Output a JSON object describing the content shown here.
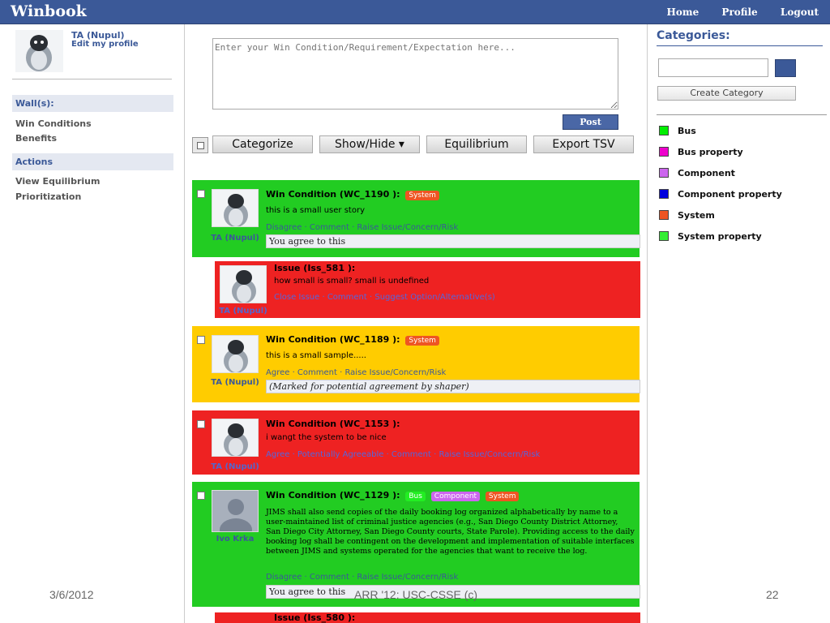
{
  "app": {
    "title": "Winbook"
  },
  "nav": {
    "home": "Home",
    "profile": "Profile",
    "logout": "Logout"
  },
  "user": {
    "name": "TA (Nupul)",
    "edit": "Edit my profile"
  },
  "sidebar": {
    "walls_heading": "Wall(s):",
    "wall_links": [
      "Win Conditions",
      "Benefits"
    ],
    "actions_heading": "Actions",
    "action_links": [
      "View Equilibrium",
      "Prioritization"
    ]
  },
  "composer": {
    "placeholder": "Enter your Win Condition/Requirement/Expectation here...",
    "post_label": "Post"
  },
  "toolbar": {
    "categorize": "Categorize",
    "showhide": "Show/Hide ▾",
    "equilibrium": "Equilibrium",
    "export": "Export TSV"
  },
  "cards": [
    {
      "type": "win",
      "author": "TA (Nupul)",
      "title": "Win Condition (WC_1190 ):",
      "tags": [
        "System"
      ],
      "body": "this is a small user story",
      "actions": "Disagree · Comment · Raise Issue/Concern/Risk",
      "note": "You agree to this"
    },
    {
      "type": "issue",
      "author": "TA (Nupul)",
      "title": "Issue (Iss_581 ):",
      "body": "how small is small? small is undefined",
      "actions": "Close Issue · Comment · Suggest Option/Alternative(s)"
    },
    {
      "type": "win",
      "author": "TA (Nupul)",
      "title": "Win Condition (WC_1189 ):",
      "tags": [
        "System"
      ],
      "body": "this is a small sample.....",
      "actions": "Agree · Comment · Raise Issue/Concern/Risk",
      "note": "(Marked for potential agreement by shaper)"
    },
    {
      "type": "win",
      "author": "TA (Nupul)",
      "title": "Win Condition (WC_1153 ):",
      "body": "i wangt the system to be nice",
      "actions": "Agree · Potentially Agreeable · Comment · Raise Issue/Concern/Risk"
    },
    {
      "type": "win",
      "author": "Ivo Krka",
      "title": "Win Condition (WC_1129 ):",
      "tags": [
        "Bus",
        "Component",
        "System"
      ],
      "body": "JIMS shall also send copies of the daily booking log organized alphabetically by name to a user-maintained list of criminal justice agencies (e.g., San Diego County District Attorney, San Diego City Attorney, San Diego County courts, State Parole). Providing access to the daily booking log shall be contingent on the development and implementation of suitable interfaces between JIMS and systems operated for the agencies that want to receive the log.",
      "actions": "Disagree · Comment · Raise Issue/Concern/Risk",
      "note": "You agree to this"
    },
    {
      "type": "issue",
      "title": "Issue (Iss_580 ):"
    }
  ],
  "tag_colors": {
    "Bus": "#22cc22",
    "Component": "#cc66ee",
    "System": "#ee5522"
  },
  "categories": {
    "heading": "Categories:",
    "create_label": "Create Category",
    "items": [
      {
        "label": "Bus",
        "color": "#00ee00"
      },
      {
        "label": "Bus property",
        "color": "#ee00cc"
      },
      {
        "label": "Component",
        "color": "#cc66ee"
      },
      {
        "label": "Component property",
        "color": "#0000dd"
      },
      {
        "label": "System",
        "color": "#ee5522"
      },
      {
        "label": "System property",
        "color": "#33ee33"
      }
    ]
  },
  "footer": {
    "date": "3/6/2012",
    "center": "ARR '12: USC-CSSE (c)",
    "page": "22"
  }
}
